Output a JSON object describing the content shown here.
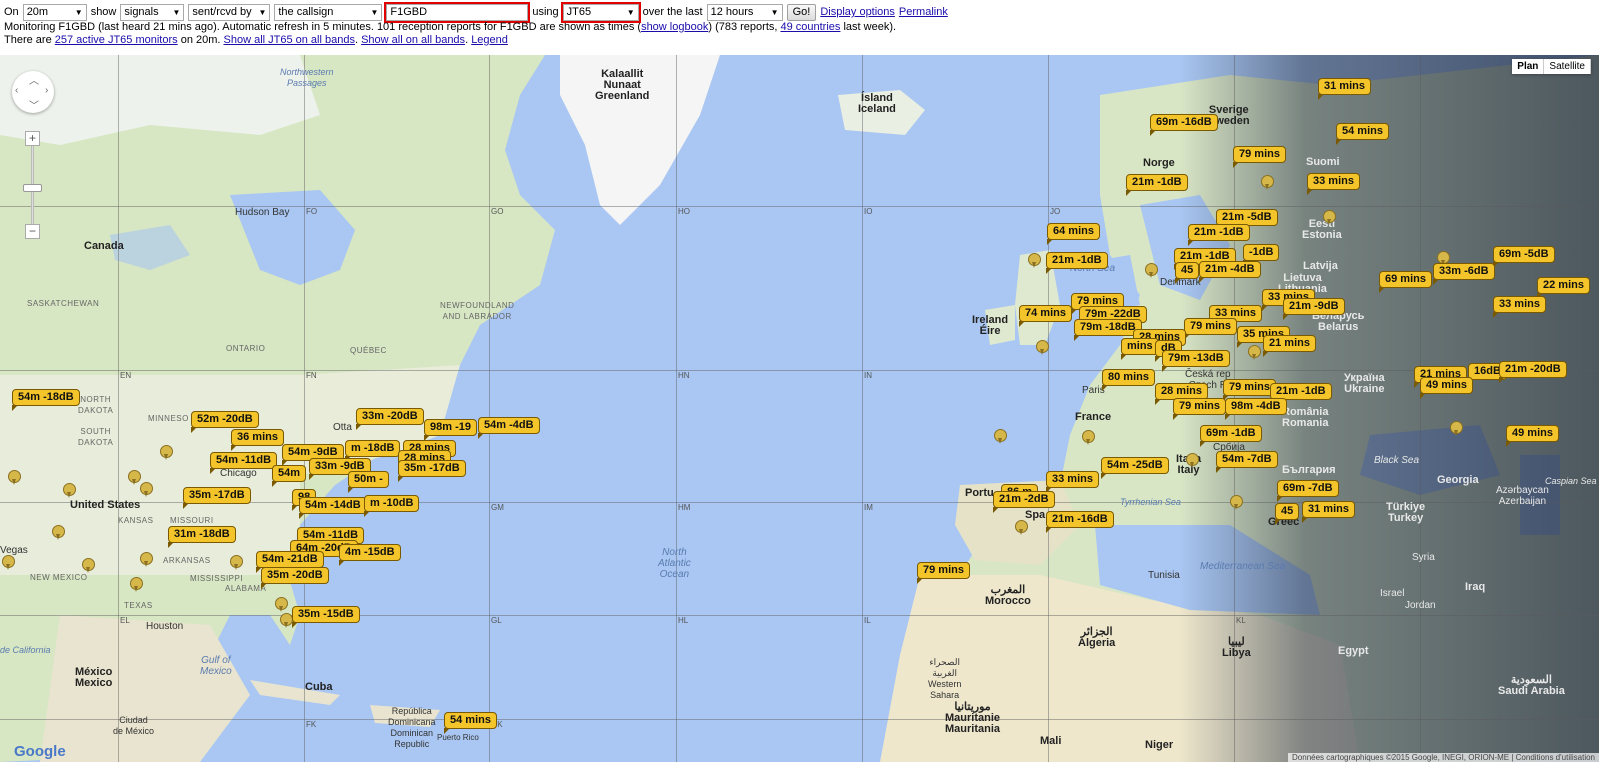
{
  "toolbar": {
    "on_label": "On",
    "band": "20m",
    "show_label": "show",
    "show_value": "signals",
    "direction": "sent/rcvd by",
    "target_type": "the callsign",
    "callsign": "F1GBD",
    "using_label": "using",
    "mode": "JT65",
    "over_label": "over the last",
    "period": "12 hours",
    "go": "Go!",
    "display_options": "Display options",
    "permalink": "Permalink"
  },
  "status": {
    "line2_a": "Monitoring F1GBD (last heard 21 mins ago). Automatic refresh in 5 minutes. 101 reception reports for F1GBD are shown as times (",
    "show_logbook": "show logbook",
    "line2_b": ") (783 reports, ",
    "countries": "49 countries",
    "line2_c": " last week).",
    "line3_a": "There are ",
    "active_monitors": "257 active JT65 monitors",
    "line3_b": " on 20m. ",
    "show_all_jt65": "Show all JT65 on all bands",
    "show_all": "Show all on all bands",
    "legend": "Legend"
  },
  "map": {
    "map_type": [
      "Plan",
      "Satellite"
    ],
    "google": "Google",
    "copyright": "Données cartographiques ©2015 Google, INEGI, ORION-ME | Conditions d'utilisation",
    "grid_squares": [
      "FO",
      "GO",
      "HO",
      "IO",
      "JO",
      "EN",
      "FN",
      "HN",
      "IN",
      "GM",
      "HM",
      "IM",
      "EL",
      "FL",
      "GL",
      "HL",
      "IL",
      "KL",
      "FK",
      "GK"
    ],
    "labels": {
      "greenland": "Kalaallit\nNunaat\nGreenland",
      "iceland": "Ísland\nIceland",
      "norway": "Norge",
      "sweden": "Sverige\nSweden",
      "finland": "Suomi",
      "estonia": "Eesti\nEstonia",
      "latvia": "Latvija",
      "lithuania": "Lietuva\nLithuania",
      "belarus": "Беларусь\nBelarus",
      "ukraine": "Україна\nUkraine",
      "romania": "România\nRomania",
      "bulgaria": "България",
      "turkey": "Türkiye\nTurkey",
      "georgia": "Georgia",
      "azerbaijan": "Azərbaycan\nAzerbaijan",
      "syria": "Syria",
      "iraq": "Iraq",
      "jordan": "Jordan",
      "israel": "Israel",
      "egypt": "Egypt",
      "saudi": "السعودية\nSaudi Arabia",
      "libya": "ليبيا\nLibya",
      "algeria": "الجزائر\nAlgeria",
      "tunisia": "Tunisia",
      "morocco": "المغرب\nMorocco",
      "western_sahara": "الصحراء\nالغربية\nWestern\nSahara",
      "mauritania": "موريتانيا\nMauritanie\nMauritania",
      "mali": "Mali",
      "niger": "Niger",
      "ireland": "Ireland\nÉire",
      "france": "France",
      "paris": "Paris",
      "italy": "Italia\nItaly",
      "spain": "Spa",
      "portugal": "Portu",
      "czech": "Česká rep\nCzech R",
      "serbia": "Србија",
      "greece": "Greec",
      "denmark": "Denmark",
      "north_sea": "North Sea",
      "black_sea": "Black Sea",
      "caspian": "Caspian Sea",
      "med": "Mediterranean Sea",
      "tyrrhenian": "Tyrrhenian Sea",
      "canada": "Canada",
      "united_states": "United States",
      "mexico": "México\nMexico",
      "cuba": "Cuba",
      "dominican": "República\nDominicana\nDominican\nRepublic",
      "puerto_rico": "Puerto Rico",
      "hudson": "Hudson Bay",
      "nw_passages": "Northwestern\nPassages",
      "saskatchewan": "SASKATCHEWAN",
      "ontario": "ONTARIO",
      "quebec": "QUÉBEC",
      "newfoundland": "NEWFOUNDLAND\nAND LABRADOR",
      "north_dakota": "NORTH\nDAKOTA",
      "south_dakota": "SOUTH\nDAKOTA",
      "minnesota": "MINNESO",
      "kansas": "KANSAS",
      "missouri": "MISSOURI",
      "arkansas": "ARKANSAS",
      "mississippi": "MISSISSIPPI",
      "alabama": "ALABAMA",
      "texas": "TEXAS",
      "new_mexico": "NEW MEXICO",
      "houston": "Houston",
      "chicago": "Chicago",
      "ottawa": "Otta",
      "gulf_mexico": "Gulf of\nMexico",
      "ciudad": "Ciudad\nde México",
      "vegas": "Vegas",
      "california": "de California",
      "n_atlantic": "North\nAtlantic\nOcean"
    },
    "reports": [
      "31 mins",
      "69m -16dB",
      "54 mins",
      "79 mins",
      "33 mins",
      "21m -1dB",
      "21m -5dB",
      "21m -1dB",
      "-1dB",
      "21m -1dB",
      "21m -4dB",
      "45",
      "64 mins",
      "21m -1dB",
      "69m -5dB",
      "33m -6dB",
      "69 mins",
      "22 mins",
      "33 mins",
      "21m -9dB",
      "33 mins",
      "79 mins",
      "74 mins",
      "79m -22dB",
      "33 mins",
      "79 mins",
      "79m -18dB",
      "28 mins",
      "mins",
      "dB",
      "35 mins",
      "21 mins",
      "79m -13dB",
      "80 mins",
      "28 mins",
      "79 mins",
      "21m -1dB",
      "21 mins",
      "79 mins",
      "98m -4dB",
      "16dB",
      "21m -20dB",
      "49 mins",
      "49 mins",
      "69m -1dB",
      "54m -25dB",
      "54m -7dB",
      "33 mins",
      "69m -7dB",
      "86 m",
      "21m -2dB",
      "45",
      "31 mins",
      "21m -16dB",
      "79 mins",
      "54 mins",
      "54m -18dB",
      "52m -20dB",
      "33m -20dB",
      "98m -19",
      "54m -4dB",
      "36 mins",
      "m -18dB",
      "54m -9dB",
      "28 mins",
      "54m -11dB",
      "33m -9dB",
      "28 mins",
      "54m",
      "35m -17dB",
      "50m -",
      "35m -17dB",
      "98",
      "54m -14dB",
      "m -10dB",
      "31m -18dB",
      "54m -11dB",
      "64m -20dB",
      "4m -15dB",
      "54m -21dB",
      "35m -20dB",
      "35m -15dB"
    ]
  }
}
